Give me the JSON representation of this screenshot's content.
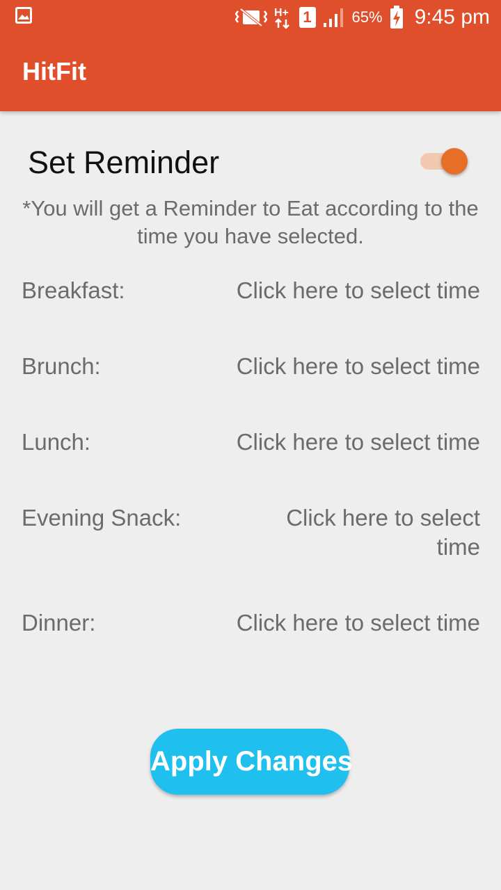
{
  "status_bar": {
    "left_icon": "image-notification-icon",
    "icons": [
      "vibrate-icon",
      "data-h-plus-icon",
      "sim-1-icon",
      "signal-icon",
      "battery-charging-icon"
    ],
    "network_type": "H+",
    "sim_slot": "1",
    "battery_percent": "65%",
    "time": "9:45 pm"
  },
  "app_bar": {
    "title": "HitFit"
  },
  "reminder": {
    "title": "Set Reminder",
    "enabled": true,
    "note": "*You will get a Reminder to Eat according to the time you have selected."
  },
  "meals": [
    {
      "label": "Breakfast:",
      "time": "Click here to select time"
    },
    {
      "label": "Brunch:",
      "time": "Click here to select time"
    },
    {
      "label": "Lunch:",
      "time": "Click here to select time"
    },
    {
      "label": "Evening Snack:",
      "time": "Click here to select time"
    },
    {
      "label": "Dinner:",
      "time": "Click here to select time"
    }
  ],
  "apply_button": {
    "label": "Apply Changes"
  },
  "colors": {
    "app_bar": "#df4f2c",
    "switch_thumb": "#e66e26",
    "switch_track": "#f0c9b0",
    "button": "#1fbfee",
    "background": "#eeeeee"
  }
}
